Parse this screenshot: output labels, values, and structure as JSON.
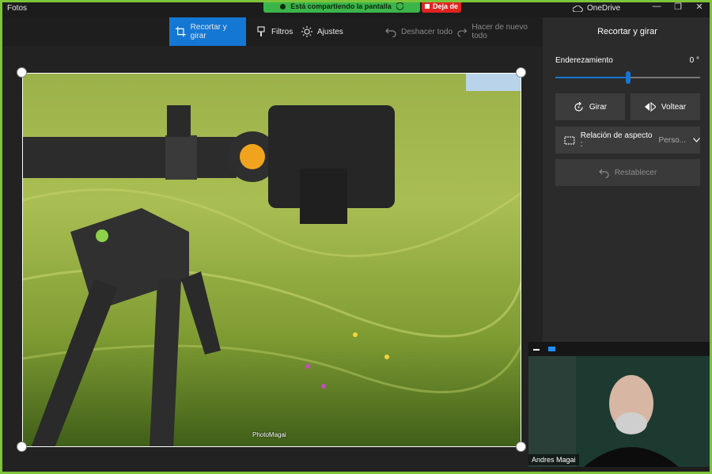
{
  "app": {
    "title": "Fotos"
  },
  "share": {
    "banner_text": "Está compartiendo la pantalla",
    "stop_label": "Deja de"
  },
  "window": {
    "onedrive_label": "OneDrive",
    "minimize": "—",
    "maximize": "❐",
    "close": "✕"
  },
  "toolbar": {
    "crop_rotate": "Recortar y girar",
    "filters": "Filtros",
    "adjustments": "Ajustes",
    "undo_all": "Deshacer todo",
    "redo_all": "Hacer de nuevo todo"
  },
  "panel": {
    "title": "Recortar y girar",
    "straighten_label": "Enderezamiento",
    "straighten_value": "0 °",
    "straighten_level": 0.5,
    "rotate_label": "Girar",
    "flip_label": "Voltear",
    "aspect_label": "Relación de aspecto :",
    "aspect_value": "Perso...",
    "reset_label": "Restablecer"
  },
  "photo": {
    "watermark": "PhotoMagai"
  },
  "video": {
    "participant_name": "Andres Magai"
  },
  "colors": {
    "accent": "#1577d4",
    "share_green": "#3bb54a",
    "stop_red": "#e0241f",
    "frame": "#7ec43a"
  }
}
